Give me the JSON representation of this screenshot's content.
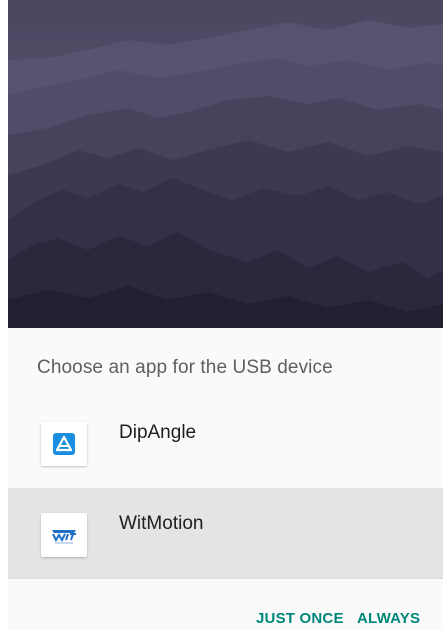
{
  "dialog": {
    "title": "Choose an app for the USB device",
    "apps": [
      {
        "label": "DipAngle",
        "icon": "dipangle-app-icon"
      },
      {
        "label": "WitMotion",
        "icon": "witmotion-app-icon",
        "selected": true
      }
    ],
    "buttons": {
      "just_once": "JUST ONCE",
      "always": "ALWAYS"
    }
  },
  "colors": {
    "accent": "#00877b",
    "selected_row": "#e4e4e4",
    "dipangle_icon": "#1a8fe0",
    "witmotion_icon": "#1f6fc4"
  }
}
